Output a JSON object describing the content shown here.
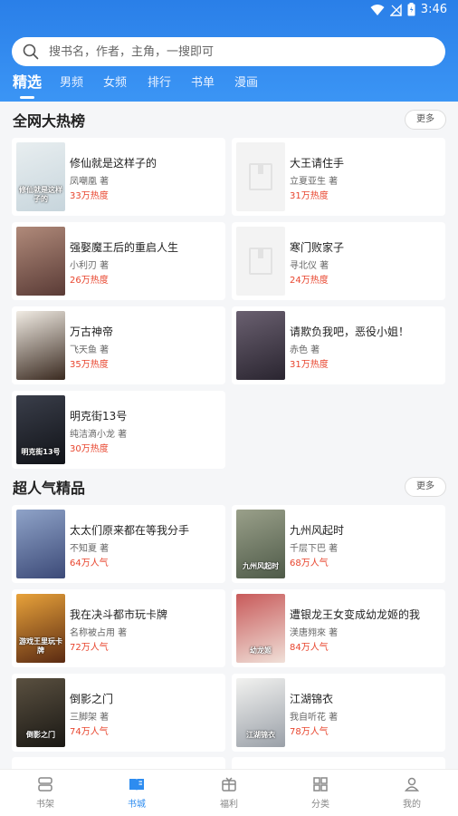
{
  "status": {
    "time": "3:46"
  },
  "search": {
    "placeholder": "搜书名，作者，主角，一搜即可"
  },
  "tabs": [
    "精选",
    "男频",
    "女频",
    "排行",
    "书单",
    "漫画"
  ],
  "sections": [
    {
      "title": "全网大热榜",
      "more": "更多",
      "books": [
        {
          "title": "修仙就是这样子的",
          "author": "凤嘲凰 著",
          "metric": "33万热度",
          "cover_colors": [
            "#e8eef0",
            "#c7d5dc"
          ],
          "cover_text": "修仙就是这样子的"
        },
        {
          "title": "大王请住手",
          "author": "立夏亚生 著",
          "metric": "31万热度",
          "placeholder": true
        },
        {
          "title": "强娶魔王后的重启人生",
          "author": "小利刃 著",
          "metric": "26万热度",
          "cover_colors": [
            "#b08a7a",
            "#5a3b36"
          ]
        },
        {
          "title": "寒门败家子",
          "author": "寻北仪 著",
          "metric": "24万热度",
          "placeholder": true
        },
        {
          "title": "万古神帝",
          "author": "飞天鱼 著",
          "metric": "35万热度",
          "cover_colors": [
            "#f1ece4",
            "#3a2a20"
          ]
        },
        {
          "title": "请欺负我吧，恶役小姐！",
          "author": "赤色 著",
          "metric": "31万热度",
          "cover_colors": [
            "#6a6070",
            "#2a2530"
          ]
        },
        {
          "title": "明克街13号",
          "author": "纯洁滴小龙 著",
          "metric": "30万热度",
          "cover_colors": [
            "#3a3e4a",
            "#111318"
          ],
          "cover_text": "明克街13号"
        }
      ]
    },
    {
      "title": "超人气精品",
      "more": "更多",
      "books": [
        {
          "title": "太太们原来都在等我分手",
          "author": "不知夏 著",
          "metric": "64万人气",
          "cover_colors": [
            "#8fa3c8",
            "#3c4a78"
          ]
        },
        {
          "title": "九州风起时",
          "author": "千层下巴 著",
          "metric": "68万人气",
          "cover_colors": [
            "#9aa08a",
            "#4e5a48"
          ],
          "cover_text": "九州风起时"
        },
        {
          "title": "我在决斗都市玩卡牌",
          "author": "名称被占用 著",
          "metric": "72万人气",
          "cover_colors": [
            "#e8a23a",
            "#5a2a12"
          ],
          "cover_text": "游戏王里玩卡牌"
        },
        {
          "title": "遭银龙王女变成幼龙姬的我",
          "author": "渼唐翙來 著",
          "metric": "84万人气",
          "cover_colors": [
            "#c85a5a",
            "#f0e0d8"
          ],
          "cover_text": "幼龙姬"
        },
        {
          "title": "倒影之门",
          "author": "三脚架 著",
          "metric": "74万人气",
          "cover_colors": [
            "#5a5040",
            "#1a1814"
          ],
          "cover_text": "倒影之门"
        },
        {
          "title": "江湖锦衣",
          "author": "我自听花 著",
          "metric": "78万人气",
          "cover_colors": [
            "#f2f2f0",
            "#9aa0a8"
          ],
          "cover_text": "江湖锦衣"
        }
      ]
    }
  ],
  "bottom_nav": [
    {
      "label": "书架",
      "icon": "bookshelf-icon"
    },
    {
      "label": "书城",
      "icon": "bookstore-icon",
      "active": true
    },
    {
      "label": "福利",
      "icon": "gift-icon"
    },
    {
      "label": "分类",
      "icon": "category-icon"
    },
    {
      "label": "我的",
      "icon": "profile-icon"
    }
  ],
  "colors": {
    "accent": "#2d8cf0",
    "heat": "#e8452e"
  }
}
